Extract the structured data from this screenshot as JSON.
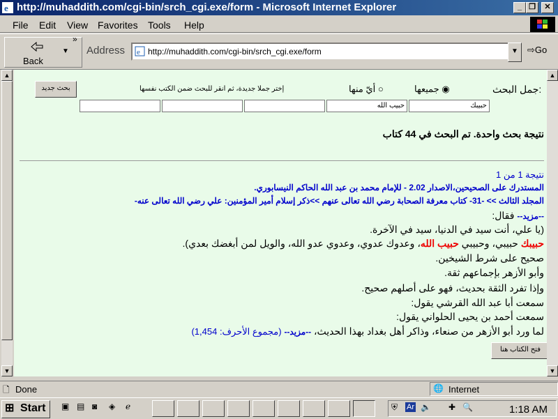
{
  "window": {
    "title": "http://muhaddith.com/cgi-bin/srch_cgi.exe/form - Microsoft Internet Explorer"
  },
  "menu": [
    "File",
    "Edit",
    "View",
    "Favorites",
    "Tools",
    "Help"
  ],
  "toolbar": {
    "back_label": "Back",
    "address_label": "Address",
    "url": "http://muhaddith.com/cgi-bin/srch_cgi.exe/form",
    "go_label": "Go"
  },
  "search": {
    "label": "جمل البحث:",
    "option_all": "جميعها",
    "option_any": "أيّ منها",
    "hint": "إختر جملا جديدة، ثم انقر للبحث ضمن الكتب نفسها",
    "new_search_button": "بحث جديد",
    "fields": [
      "حبيبك",
      "حبيب الله",
      "",
      "",
      ""
    ]
  },
  "result": {
    "summary": "نتيجة بحث واحدة. تم البحث في 44 كتاب",
    "counter": "نتيجة 1 من 1",
    "book": "المستدرك على الصحيحين،الاصدار 2.02 - للإمام محمد بن عبد الله الحاكم النيسابوري.",
    "path": "المجلد الثالث >> -31- كتاب معرفة الصحابة رضي الله تعالى عنهم >>ذكر إسلام أمير المؤمنين: علي رضي الله تعالى عنه-",
    "more_label": "--مزيد--",
    "lines": [
      "فقال:",
      "(يا علي، أنت سيد في الدنيا، سيد في الآخرة.",
      "صحيح على شرط الشيخين.",
      "وأبو الأزهر بإجماعهم ثقة.",
      "وإذا تفرد الثقة بحديث، فهو على أصلهم صحيح.",
      "سمعت أبا عبد الله القرشي يقول:",
      "سمعت أحمد بن يحيى الحلواني يقول:"
    ],
    "highlight1": "حبيبك",
    "mid_text": " حبيبي، وحبيبي ",
    "highlight2": "حبيب الله",
    "tail_text": "، وعدوك عدوي، وعدوي عدو الله، والويل لمن أبغضك بعدي).",
    "last_line": "لما ورد أبو الأزهر من صنعاء، وذاكر أهل بغداد بهذا الحديث، ",
    "more_label2": "--مزيد--",
    "char_count": "(مجموع الأحرف: 1,454)",
    "open_book_button": "فتح الكتاب هنا"
  },
  "status": {
    "left": "Done",
    "zone": "Internet"
  },
  "taskbar": {
    "start_label": "Start",
    "clock": "1:18 AM",
    "lang": "Ar"
  }
}
